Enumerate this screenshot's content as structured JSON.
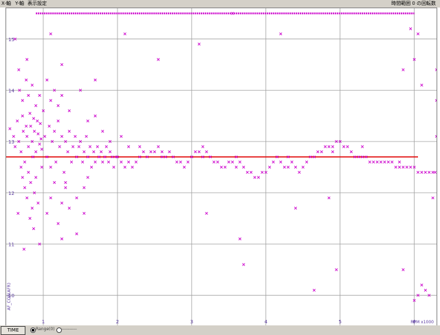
{
  "menu": {
    "item1": "X-軸",
    "item2": "Y-軸",
    "item3": "表示設定",
    "status": "時間範囲 0 の回転数"
  },
  "bottom": {
    "time_button": "TIME",
    "radio1": "Range(0)",
    "radio2": "----------"
  },
  "colors": {
    "marker": "#cc00cc",
    "reference_line": "#e00000",
    "grid": "#a0a0a0",
    "axis_text": "#5a3aa0"
  },
  "chart_data": {
    "type": "scatter",
    "xlabel": "RPM x1000",
    "ylabel": "AF_COR(AFR)",
    "xlim": [
      0.5,
      6.3
    ],
    "ylim": [
      9.4,
      15.6
    ],
    "x_ticks": [
      1,
      2,
      3,
      4,
      5,
      6
    ],
    "x_tick_labels": [
      "1",
      "2",
      "3",
      "4",
      "5",
      "6"
    ],
    "y_ticks": [
      10,
      11,
      12,
      13,
      14,
      15
    ],
    "y_tick_labels": [
      "10",
      "11",
      "12",
      "13",
      "14",
      "15"
    ],
    "reference_line": {
      "y": 12.7,
      "x_start": 0.5,
      "x_end": 6.05
    },
    "top_marker_row": {
      "y": 15.5,
      "x_start": 0.9,
      "x_end": 6.0
    },
    "marker": "x",
    "series": [
      {
        "points": [
          [
            0.55,
            13.25
          ],
          [
            0.6,
            13.1
          ],
          [
            0.62,
            12.9
          ],
          [
            0.65,
            13.4
          ],
          [
            0.67,
            13.0
          ],
          [
            0.7,
            12.8
          ],
          [
            0.72,
            13.5
          ],
          [
            0.73,
            13.2
          ],
          [
            0.75,
            12.6
          ],
          [
            0.77,
            13.3
          ],
          [
            0.78,
            13.1
          ],
          [
            0.8,
            12.9
          ],
          [
            0.82,
            13.55
          ],
          [
            0.83,
            13.3
          ],
          [
            0.85,
            13.0
          ],
          [
            0.86,
            12.7
          ],
          [
            0.87,
            13.45
          ],
          [
            0.88,
            13.2
          ],
          [
            0.9,
            12.8
          ],
          [
            0.92,
            13.4
          ],
          [
            0.93,
            13.15
          ],
          [
            0.95,
            12.95
          ],
          [
            0.96,
            13.35
          ],
          [
            0.97,
            13.05
          ],
          [
            0.98,
            12.85
          ],
          [
            0.7,
            12.5
          ],
          [
            0.72,
            12.3
          ],
          [
            0.75,
            12.1
          ],
          [
            0.78,
            11.9
          ],
          [
            0.8,
            12.4
          ],
          [
            0.83,
            12.2
          ],
          [
            0.85,
            11.7
          ],
          [
            0.88,
            12.0
          ],
          [
            0.9,
            12.3
          ],
          [
            0.68,
            14.0
          ],
          [
            0.72,
            13.8
          ],
          [
            0.77,
            14.2
          ],
          [
            0.8,
            13.9
          ],
          [
            0.85,
            14.1
          ],
          [
            0.9,
            13.7
          ],
          [
            0.95,
            13.9
          ],
          [
            0.62,
            15.0
          ],
          [
            0.67,
            14.4
          ],
          [
            0.78,
            14.6
          ],
          [
            0.82,
            11.5
          ],
          [
            0.87,
            11.3
          ],
          [
            0.93,
            11.8
          ],
          [
            0.98,
            12.5
          ],
          [
            0.74,
            10.9
          ],
          [
            0.66,
            11.6
          ],
          [
            1.0,
            13.6
          ],
          [
            1.02,
            13.1
          ],
          [
            1.05,
            12.7
          ],
          [
            1.08,
            13.3
          ],
          [
            1.1,
            12.5
          ],
          [
            1.12,
            13.0
          ],
          [
            1.15,
            13.2
          ],
          [
            1.17,
            12.6
          ],
          [
            1.2,
            13.4
          ],
          [
            1.22,
            12.9
          ],
          [
            1.25,
            13.1
          ],
          [
            1.28,
            12.4
          ],
          [
            1.3,
            13.0
          ],
          [
            1.33,
            12.8
          ],
          [
            1.35,
            13.2
          ],
          [
            1.38,
            12.6
          ],
          [
            1.4,
            12.9
          ],
          [
            1.43,
            13.1
          ],
          [
            1.45,
            12.7
          ],
          [
            1.48,
            12.9
          ],
          [
            1.5,
            13.0
          ],
          [
            1.53,
            12.6
          ],
          [
            1.55,
            12.8
          ],
          [
            1.58,
            13.1
          ],
          [
            1.6,
            12.7
          ],
          [
            1.63,
            12.9
          ],
          [
            1.65,
            12.5
          ],
          [
            1.68,
            12.8
          ],
          [
            1.7,
            12.6
          ],
          [
            1.73,
            12.9
          ],
          [
            1.75,
            12.7
          ],
          [
            1.78,
            12.8
          ],
          [
            1.8,
            12.6
          ],
          [
            1.83,
            12.7
          ],
          [
            1.85,
            12.9
          ],
          [
            1.88,
            12.6
          ],
          [
            1.9,
            12.8
          ],
          [
            1.93,
            12.7
          ],
          [
            1.95,
            12.5
          ],
          [
            1.98,
            12.7
          ],
          [
            1.05,
            11.6
          ],
          [
            1.1,
            11.9
          ],
          [
            1.15,
            12.2
          ],
          [
            1.2,
            11.4
          ],
          [
            1.25,
            11.8
          ],
          [
            1.3,
            12.2
          ],
          [
            1.35,
            11.7
          ],
          [
            1.45,
            11.9
          ],
          [
            1.55,
            12.1
          ],
          [
            1.6,
            12.3
          ],
          [
            1.05,
            14.2
          ],
          [
            1.1,
            13.8
          ],
          [
            1.15,
            14.0
          ],
          [
            1.2,
            13.7
          ],
          [
            1.25,
            13.9
          ],
          [
            1.35,
            13.6
          ],
          [
            1.5,
            14.0
          ],
          [
            1.6,
            13.4
          ],
          [
            1.1,
            15.1
          ],
          [
            1.25,
            14.5
          ],
          [
            1.3,
            12.1
          ],
          [
            1.7,
            13.5
          ],
          [
            1.8,
            13.2
          ],
          [
            1.9,
            13.0
          ],
          [
            2.05,
            13.1
          ],
          [
            2.15,
            12.9
          ],
          [
            2.0,
            12.7
          ],
          [
            2.05,
            12.6
          ],
          [
            2.1,
            12.5
          ],
          [
            2.15,
            12.6
          ],
          [
            2.2,
            12.5
          ],
          [
            2.25,
            12.6
          ],
          [
            2.3,
            12.7
          ],
          [
            2.35,
            12.8
          ],
          [
            2.4,
            12.7
          ],
          [
            2.45,
            12.8
          ],
          [
            2.5,
            12.8
          ],
          [
            2.55,
            12.9
          ],
          [
            2.6,
            12.8
          ],
          [
            2.65,
            12.7
          ],
          [
            2.7,
            12.8
          ],
          [
            2.75,
            12.7
          ],
          [
            2.8,
            12.6
          ],
          [
            2.85,
            12.6
          ],
          [
            2.9,
            12.5
          ],
          [
            2.95,
            12.6
          ],
          [
            3.0,
            12.7
          ],
          [
            3.05,
            12.8
          ],
          [
            3.1,
            12.8
          ],
          [
            3.15,
            12.7
          ],
          [
            3.2,
            12.8
          ],
          [
            3.25,
            12.7
          ],
          [
            3.3,
            12.6
          ],
          [
            3.35,
            12.6
          ],
          [
            3.4,
            12.5
          ],
          [
            3.45,
            12.5
          ],
          [
            3.5,
            12.6
          ],
          [
            3.55,
            12.6
          ],
          [
            3.6,
            12.7
          ],
          [
            3.65,
            12.6
          ],
          [
            3.7,
            12.5
          ],
          [
            3.75,
            12.4
          ],
          [
            3.8,
            12.4
          ],
          [
            3.85,
            12.3
          ],
          [
            3.9,
            12.3
          ],
          [
            3.95,
            12.4
          ],
          [
            4.0,
            12.4
          ],
          [
            4.05,
            12.5
          ],
          [
            4.1,
            12.6
          ],
          [
            4.15,
            12.7
          ],
          [
            4.2,
            12.6
          ],
          [
            4.25,
            12.5
          ],
          [
            4.3,
            12.5
          ],
          [
            4.35,
            12.6
          ],
          [
            4.4,
            12.5
          ],
          [
            4.45,
            12.4
          ],
          [
            4.5,
            12.5
          ],
          [
            4.55,
            12.6
          ],
          [
            4.6,
            12.7
          ],
          [
            4.65,
            12.7
          ],
          [
            4.7,
            12.8
          ],
          [
            4.75,
            12.8
          ],
          [
            4.8,
            12.9
          ],
          [
            4.85,
            12.9
          ],
          [
            4.9,
            12.9
          ],
          [
            4.95,
            13.0
          ],
          [
            5.0,
            13.0
          ],
          [
            5.05,
            12.9
          ],
          [
            5.1,
            12.9
          ],
          [
            5.15,
            12.8
          ],
          [
            5.2,
            12.7
          ],
          [
            5.25,
            12.7
          ],
          [
            5.3,
            12.7
          ],
          [
            5.35,
            12.7
          ],
          [
            5.4,
            12.6
          ],
          [
            5.45,
            12.6
          ],
          [
            5.5,
            12.6
          ],
          [
            5.55,
            12.6
          ],
          [
            5.6,
            12.6
          ],
          [
            5.65,
            12.6
          ],
          [
            5.7,
            12.6
          ],
          [
            5.75,
            12.5
          ],
          [
            5.8,
            12.5
          ],
          [
            5.85,
            12.5
          ],
          [
            5.9,
            12.5
          ],
          [
            5.95,
            12.5
          ],
          [
            6.0,
            12.5
          ],
          [
            6.05,
            12.4
          ],
          [
            6.1,
            12.4
          ],
          [
            6.15,
            12.4
          ],
          [
            6.2,
            12.4
          ],
          [
            6.25,
            12.4
          ],
          [
            6.28,
            12.4
          ],
          [
            2.3,
            12.9
          ],
          [
            2.6,
            12.7
          ],
          [
            3.15,
            12.9
          ],
          [
            3.6,
            12.5
          ],
          [
            4.3,
            12.7
          ],
          [
            4.9,
            12.8
          ],
          [
            5.3,
            12.9
          ],
          [
            5.8,
            12.6
          ],
          [
            1.7,
            14.2
          ],
          [
            2.1,
            15.1
          ],
          [
            2.55,
            14.6
          ],
          [
            3.1,
            14.9
          ],
          [
            3.55,
            15.5
          ],
          [
            4.2,
            15.1
          ],
          [
            4.65,
            10.1
          ],
          [
            4.4,
            11.7
          ],
          [
            3.65,
            11.1
          ],
          [
            3.7,
            10.6
          ],
          [
            3.2,
            11.6
          ],
          [
            4.85,
            11.9
          ],
          [
            5.85,
            10.5
          ],
          [
            5.9,
            15.7
          ],
          [
            5.95,
            15.2
          ],
          [
            6.0,
            9.9
          ],
          [
            6.05,
            10.0
          ],
          [
            6.1,
            10.2
          ],
          [
            6.15,
            10.1
          ],
          [
            6.2,
            10.0
          ],
          [
            6.25,
            11.9
          ],
          [
            6.3,
            14.4
          ],
          [
            6.3,
            13.8
          ],
          [
            6.3,
            13.1
          ],
          [
            6.1,
            14.1
          ],
          [
            6.05,
            15.1
          ],
          [
            5.85,
            14.4
          ],
          [
            6.0,
            14.6
          ],
          [
            4.95,
            10.5
          ],
          [
            1.45,
            11.2
          ],
          [
            0.95,
            11.0
          ],
          [
            1.55,
            11.6
          ],
          [
            1.25,
            11.1
          ]
        ]
      }
    ]
  }
}
